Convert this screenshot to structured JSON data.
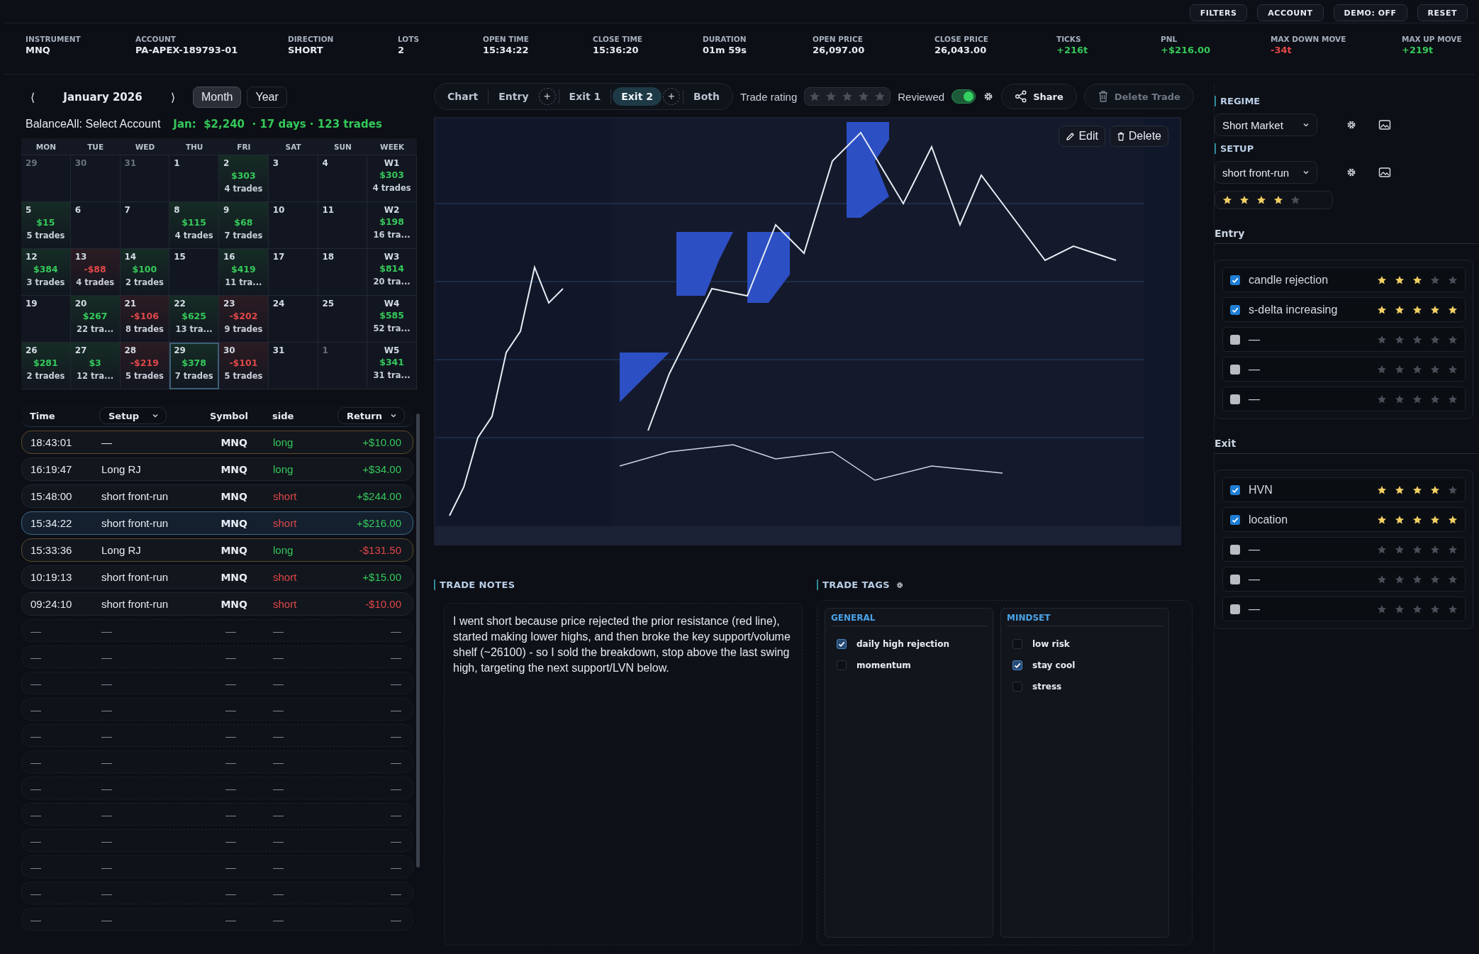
{
  "top_buttons": [
    "FILTERS",
    "ACCOUNT",
    "DEMO: OFF",
    "RESET"
  ],
  "stats": [
    {
      "label": "INSTRUMENT",
      "value": "MNQ",
      "color": "#e6ebf2"
    },
    {
      "label": "ACCOUNT",
      "value": "PA-APEX-189793-01",
      "color": "#e6ebf2"
    },
    {
      "label": "DIRECTION",
      "value": "SHORT",
      "color": "#e6ebf2"
    },
    {
      "label": "LOTS",
      "value": "2",
      "color": "#e6ebf2"
    },
    {
      "label": "OPEN TIME",
      "value": "15:34:22",
      "color": "#e6ebf2"
    },
    {
      "label": "CLOSE TIME",
      "value": "15:36:20",
      "color": "#e6ebf2"
    },
    {
      "label": "DURATION",
      "value": "01m 59s",
      "color": "#e6ebf2"
    },
    {
      "label": "OPEN PRICE",
      "value": "26,097.00",
      "color": "#e6ebf2"
    },
    {
      "label": "CLOSE PRICE",
      "value": "26,043.00",
      "color": "#e6ebf2"
    },
    {
      "label": "TICKS",
      "value": "+216t",
      "color": "#35c85a"
    },
    {
      "label": "PNL",
      "value": "+$216.00",
      "color": "#35c85a"
    },
    {
      "label": "MAX DOWN MOVE",
      "value": "-34t",
      "color": "#e04848"
    },
    {
      "label": "MAX UP MOVE",
      "value": "+219t",
      "color": "#35c85a"
    }
  ],
  "calendar": {
    "prev": "⟨",
    "title": "January 2026",
    "next": "⟩",
    "views": [
      {
        "label": "Month",
        "selected": true
      },
      {
        "label": "Year",
        "selected": false
      }
    ],
    "balance_label": "BalanceAll: Select Account",
    "summary": "Jan:  $2,240  · 17 days · 123 trades",
    "weekday_headers": [
      "MON",
      "TUE",
      "WED",
      "THU",
      "FRI",
      "SAT",
      "SUN",
      "WEEK"
    ],
    "weeks": [
      {
        "days": [
          {
            "day": "29",
            "muted": true,
            "selected": false
          },
          {
            "day": "30",
            "muted": true,
            "selected": false
          },
          {
            "day": "31",
            "muted": true,
            "selected": false
          },
          {
            "day": "1",
            "muted": false,
            "selected": false
          },
          {
            "day": "2",
            "muted": false,
            "selected": false,
            "color": "#35c85a",
            "pnl": "$303",
            "trades": "4 trades"
          },
          {
            "day": "3",
            "muted": false,
            "selected": false
          },
          {
            "day": "4",
            "muted": false,
            "selected": false
          }
        ],
        "week": {
          "label": "W1",
          "pnl": "$303",
          "trades": "4 trades"
        }
      },
      {
        "days": [
          {
            "day": "5",
            "muted": false,
            "selected": false,
            "color": "#35c85a",
            "pnl": "$15",
            "trades": "5 trades"
          },
          {
            "day": "6",
            "muted": false,
            "selected": false
          },
          {
            "day": "7",
            "muted": false,
            "selected": false
          },
          {
            "day": "8",
            "muted": false,
            "selected": false,
            "color": "#35c85a",
            "pnl": "$115",
            "trades": "4 trades"
          },
          {
            "day": "9",
            "muted": false,
            "selected": false,
            "color": "#35c85a",
            "pnl": "$68",
            "trades": "7 trades"
          },
          {
            "day": "10",
            "muted": false,
            "selected": false
          },
          {
            "day": "11",
            "muted": false,
            "selected": false
          }
        ],
        "week": {
          "label": "W2",
          "pnl": "$198",
          "trades": "16 tra..."
        }
      },
      {
        "days": [
          {
            "day": "12",
            "muted": false,
            "selected": false,
            "color": "#35c85a",
            "pnl": "$384",
            "trades": "3 trades"
          },
          {
            "day": "13",
            "muted": false,
            "selected": false,
            "color": "#e04848",
            "pnl": "-$88",
            "trades": "4 trades"
          },
          {
            "day": "14",
            "muted": false,
            "selected": false,
            "color": "#35c85a",
            "pnl": "$100",
            "trades": "2 trades"
          },
          {
            "day": "15",
            "muted": false,
            "selected": false
          },
          {
            "day": "16",
            "muted": false,
            "selected": false,
            "color": "#35c85a",
            "pnl": "$419",
            "trades": "11 tra..."
          },
          {
            "day": "17",
            "muted": false,
            "selected": false
          },
          {
            "day": "18",
            "muted": false,
            "selected": false
          }
        ],
        "week": {
          "label": "W3",
          "pnl": "$814",
          "trades": "20 tra..."
        }
      },
      {
        "days": [
          {
            "day": "19",
            "muted": false,
            "selected": false
          },
          {
            "day": "20",
            "muted": false,
            "selected": false,
            "color": "#35c85a",
            "pnl": "$267",
            "trades": "22 tra..."
          },
          {
            "day": "21",
            "muted": false,
            "selected": false,
            "color": "#e04848",
            "pnl": "-$106",
            "trades": "8 trades"
          },
          {
            "day": "22",
            "muted": false,
            "selected": false,
            "color": "#35c85a",
            "pnl": "$625",
            "trades": "13 tra..."
          },
          {
            "day": "23",
            "muted": false,
            "selected": false,
            "color": "#e04848",
            "pnl": "-$202",
            "trades": "9 trades"
          },
          {
            "day": "24",
            "muted": false,
            "selected": false
          },
          {
            "day": "25",
            "muted": false,
            "selected": false
          }
        ],
        "week": {
          "label": "W4",
          "pnl": "$585",
          "trades": "52 tra..."
        }
      },
      {
        "days": [
          {
            "day": "26",
            "muted": false,
            "selected": false,
            "color": "#35c85a",
            "pnl": "$281",
            "trades": "2 trades"
          },
          {
            "day": "27",
            "muted": false,
            "selected": false,
            "color": "#35c85a",
            "pnl": "$3",
            "trades": "12 tra..."
          },
          {
            "day": "28",
            "muted": false,
            "selected": false,
            "color": "#e04848",
            "pnl": "-$219",
            "trades": "5 trades"
          },
          {
            "day": "29",
            "muted": false,
            "selected": true,
            "color": "#35c85a",
            "pnl": "$378",
            "trades": "7 trades"
          },
          {
            "day": "30",
            "muted": false,
            "selected": false,
            "color": "#e04848",
            "pnl": "-$101",
            "trades": "5 trades"
          },
          {
            "day": "31",
            "muted": false,
            "selected": false
          },
          {
            "day": "1",
            "muted": true,
            "selected": false
          }
        ],
        "week": {
          "label": "W5",
          "pnl": "$341",
          "trades": "31 tra..."
        }
      }
    ]
  },
  "trades": {
    "columns": [
      {
        "label": "Time",
        "dropdown": false
      },
      {
        "label": "Setup",
        "dropdown": true
      },
      {
        "label": "Symbol",
        "dropdown": false
      },
      {
        "label": "side",
        "dropdown": false
      },
      {
        "label": "Return",
        "dropdown": true
      }
    ],
    "rows": [
      {
        "time": "18:43:01",
        "setup": "—",
        "symbol": "MNQ",
        "side": {
          "text": "long",
          "color": "#35c85a"
        },
        "return": {
          "text": "+$10.00",
          "color": "#35c85a"
        },
        "selected": false,
        "flagged": true
      },
      {
        "time": "16:19:47",
        "setup": "Long RJ",
        "symbol": "MNQ",
        "side": {
          "text": "long",
          "color": "#35c85a"
        },
        "return": {
          "text": "+$34.00",
          "color": "#35c85a"
        },
        "selected": false,
        "flagged": false
      },
      {
        "time": "15:48:00",
        "setup": "short front-run",
        "symbol": "MNQ",
        "side": {
          "text": "short",
          "color": "#e04848"
        },
        "return": {
          "text": "+$244.00",
          "color": "#35c85a"
        },
        "selected": false,
        "flagged": false
      },
      {
        "time": "15:34:22",
        "setup": "short front-run",
        "symbol": "MNQ",
        "side": {
          "text": "short",
          "color": "#e04848"
        },
        "return": {
          "text": "+$216.00",
          "color": "#35c85a"
        },
        "selected": true,
        "flagged": false
      },
      {
        "time": "15:33:36",
        "setup": "Long RJ",
        "symbol": "MNQ",
        "side": {
          "text": "long",
          "color": "#35c85a"
        },
        "return": {
          "text": "-$131.50",
          "color": "#e04848"
        },
        "selected": false,
        "flagged": true
      },
      {
        "time": "10:19:13",
        "setup": "short front-run",
        "symbol": "MNQ",
        "side": {
          "text": "short",
          "color": "#e04848"
        },
        "return": {
          "text": "+$15.00",
          "color": "#35c85a"
        },
        "selected": false,
        "flagged": false
      },
      {
        "time": "09:24:10",
        "setup": "short front-run",
        "symbol": "MNQ",
        "side": {
          "text": "short",
          "color": "#e04848"
        },
        "return": {
          "text": "-$10.00",
          "color": "#e04848"
        },
        "selected": false,
        "flagged": false
      }
    ],
    "empty_rows": [
      [
        "—",
        "—",
        "—",
        "—",
        "—"
      ],
      [
        "—",
        "—",
        "—",
        "—",
        "—"
      ],
      [
        "—",
        "—",
        "—",
        "—",
        "—"
      ],
      [
        "—",
        "—",
        "—",
        "—",
        "—"
      ],
      [
        "—",
        "—",
        "—",
        "—",
        "—"
      ],
      [
        "—",
        "—",
        "—",
        "—",
        "—"
      ],
      [
        "—",
        "—",
        "—",
        "—",
        "—"
      ],
      [
        "—",
        "—",
        "—",
        "—",
        "—"
      ],
      [
        "—",
        "—",
        "—",
        "—",
        "—"
      ],
      [
        "—",
        "—",
        "—",
        "—",
        "—"
      ],
      [
        "—",
        "—",
        "—",
        "—",
        "—"
      ],
      [
        "—",
        "—",
        "—",
        "—",
        "—"
      ]
    ]
  },
  "toolbar": {
    "tabs": [
      {
        "kind": "tab",
        "label": "Chart",
        "selected": false
      },
      {
        "kind": "tab",
        "label": "Entry",
        "selected": false
      },
      {
        "kind": "add",
        "label": "+",
        "selected": false
      },
      {
        "kind": "tab",
        "label": "Exit 1",
        "selected": false
      },
      {
        "kind": "tab",
        "label": "Exit 2",
        "selected": true
      },
      {
        "kind": "add",
        "label": "+",
        "selected": false
      },
      {
        "kind": "tab",
        "label": "Both",
        "selected": false
      }
    ],
    "rating_label": "Trade rating",
    "stars": 0,
    "reviewed_label": "Reviewed",
    "reviewed": true,
    "share": "Share",
    "delete": {
      "label": "Delete Trade",
      "disabled": true
    }
  },
  "chart_image": {
    "kind": "picture",
    "edit": "Edit",
    "delete": "Delete"
  },
  "notes": {
    "title": "TRADE NOTES",
    "text": "I went short because price rejected the prior resistance (red line), started making lower highs, and then broke the key support/volume shelf (~26100) - so I sold the breakdown, stop above the last swing high, targeting the next support/LVN below."
  },
  "tags": {
    "title": "TRADE TAGS",
    "groups": [
      {
        "title": "GENERAL",
        "items": [
          {
            "label": "daily high rejection",
            "checked": true
          },
          {
            "label": "momentum",
            "checked": false
          }
        ]
      },
      {
        "title": "MINDSET",
        "items": [
          {
            "label": "low risk",
            "checked": false
          },
          {
            "label": "stay cool",
            "checked": true
          },
          {
            "label": "stress",
            "checked": false
          }
        ]
      }
    ]
  },
  "side_panel": {
    "regime": {
      "title": "REGIME",
      "value": "Short Market"
    },
    "setup": {
      "title": "SETUP",
      "value": "short front-run",
      "stars": 4
    },
    "sections": [
      {
        "title": "Entry",
        "items": [
          {
            "label": "candle rejection",
            "checked": true,
            "stars": 3
          },
          {
            "label": "s-delta increasing",
            "checked": true,
            "stars": 5
          },
          {
            "label": "—",
            "checked": false,
            "stars": 0
          },
          {
            "label": "—",
            "checked": false,
            "stars": 0
          },
          {
            "label": "—",
            "checked": false,
            "stars": 0
          }
        ]
      },
      {
        "title": "Exit",
        "items": [
          {
            "label": "HVN",
            "checked": true,
            "stars": 4
          },
          {
            "label": "location",
            "checked": true,
            "stars": 5
          },
          {
            "label": "—",
            "checked": false,
            "stars": 0
          },
          {
            "label": "—",
            "checked": false,
            "stars": 0
          },
          {
            "label": "—",
            "checked": false,
            "stars": 0
          }
        ]
      }
    ]
  }
}
